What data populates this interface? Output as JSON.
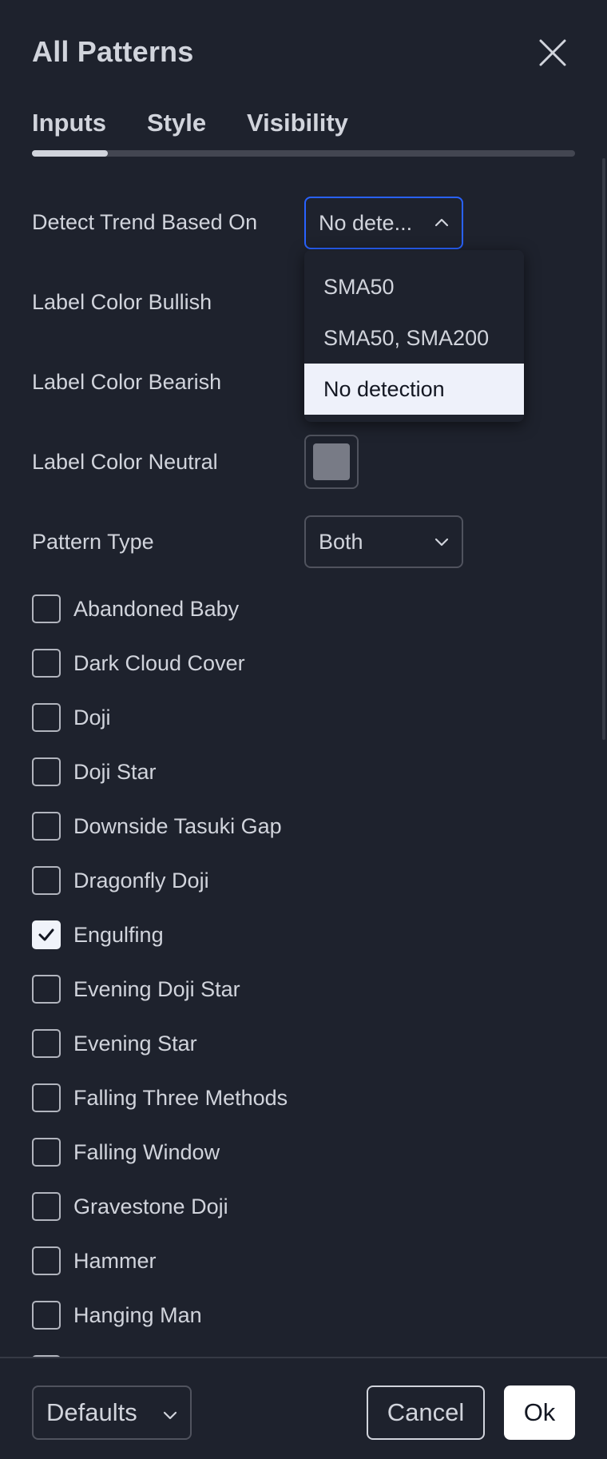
{
  "dialog": {
    "title": "All Patterns"
  },
  "tabs": [
    {
      "label": "Inputs",
      "active": true
    },
    {
      "label": "Style",
      "active": false
    },
    {
      "label": "Visibility",
      "active": false
    }
  ],
  "inputs": {
    "detect_trend": {
      "label": "Detect Trend Based On",
      "value": "No dete...",
      "options": [
        "SMA50",
        "SMA50, SMA200",
        "No detection"
      ],
      "selected_option": "No detection",
      "expanded": true
    },
    "label_color_bullish": {
      "label": "Label Color Bullish"
    },
    "label_color_bearish": {
      "label": "Label Color Bearish"
    },
    "label_color_neutral": {
      "label": "Label Color Neutral",
      "color": "#787b86"
    },
    "pattern_type": {
      "label": "Pattern Type",
      "value": "Both"
    }
  },
  "patterns": [
    {
      "label": "Abandoned Baby",
      "checked": false
    },
    {
      "label": "Dark Cloud Cover",
      "checked": false
    },
    {
      "label": "Doji",
      "checked": false
    },
    {
      "label": "Doji Star",
      "checked": false
    },
    {
      "label": "Downside Tasuki Gap",
      "checked": false
    },
    {
      "label": "Dragonfly Doji",
      "checked": false
    },
    {
      "label": "Engulfing",
      "checked": true
    },
    {
      "label": "Evening Doji Star",
      "checked": false
    },
    {
      "label": "Evening Star",
      "checked": false
    },
    {
      "label": "Falling Three Methods",
      "checked": false
    },
    {
      "label": "Falling Window",
      "checked": false
    },
    {
      "label": "Gravestone Doji",
      "checked": false
    },
    {
      "label": "Hammer",
      "checked": false
    },
    {
      "label": "Hanging Man",
      "checked": false
    }
  ],
  "footer": {
    "defaults_label": "Defaults",
    "cancel_label": "Cancel",
    "ok_label": "Ok"
  },
  "colors": {
    "background": "#1e222d",
    "text": "#d1d4dc",
    "focus_border": "#2962ff",
    "selected_option_bg": "#eef1fa"
  },
  "icons": {
    "close": "close-icon",
    "chevron_up": "chevron-up-icon",
    "chevron_down": "chevron-down-icon",
    "check": "checkmark-icon"
  }
}
